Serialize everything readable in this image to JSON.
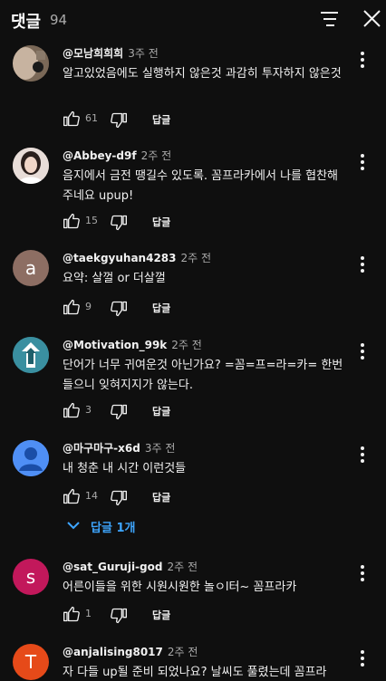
{
  "header": {
    "title": "댓글",
    "count": "94"
  },
  "labels": {
    "reply": "답글"
  },
  "comments": [
    {
      "author": "@모남희희희",
      "time": "3주 전",
      "text": "알고있었음에도 실행하지 않은것 과감히 투자하지 않은것",
      "likes": "61",
      "avatar_color": "#6b5a4a"
    },
    {
      "author": "@Abbey-d9f",
      "time": "2주 전",
      "text": "음지에서  금전 땡길수 있도록. 꼼프라카에서 나를 협찬해주네요 upup!",
      "likes": "15",
      "avatar_color": "#d8c8c0"
    },
    {
      "author": "@taekgyuhan4283",
      "time": "2주 전",
      "text": "요약: 살껄 or 더살껄",
      "likes": "9",
      "avatar_letter": "a",
      "avatar_color": "#8d6e63"
    },
    {
      "author": "@Motivation_99k",
      "time": "2주 전",
      "text": "단어가 너무 귀여운것 아닌가요? =꼼=프=라=카= 한번 들으니 잊혀지지가 않는다.",
      "likes": "3",
      "avatar_color": "#2e7d8c"
    },
    {
      "author": "@마구마구-x6d",
      "time": "3주 전",
      "text": "내 청춘 내 시간 이런것들",
      "likes": "14",
      "avatar_color": "#4f8ff5"
    },
    {
      "author": "@sat_Guruji-god",
      "time": "2주 전",
      "text": "어른이들을 위한 시원시원한 놀ㅇl터~ 꼼프라카",
      "likes": "1",
      "avatar_letter": "s",
      "avatar_color": "#c2185b"
    },
    {
      "author": "@anjalising8017",
      "time": "2주 전",
      "text": "자 다들 up될 준비 되었나요? 날씨도 풀렸는데 꼼프라",
      "likes": "",
      "avatar_letter": "T",
      "avatar_color": "#e64a19"
    }
  ],
  "replies_toggle": {
    "label": "답글 1개"
  },
  "colors": {
    "background": "#0f0f0f",
    "link": "#3ea6ff",
    "secondary_text": "#aaaaaa"
  },
  "icons": [
    "sort-icon",
    "close-icon",
    "more-vert-icon",
    "thumb-up-icon",
    "thumb-down-icon",
    "chevron-down-icon"
  ]
}
